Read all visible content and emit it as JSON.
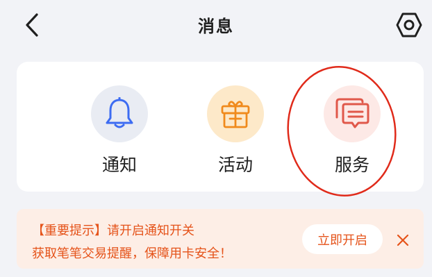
{
  "header": {
    "title": "消息",
    "back_icon": "chevron-left-icon",
    "settings_icon": "hexagon-gear-icon"
  },
  "categories": [
    {
      "label": "通知",
      "icon": "bell-icon",
      "bg_color": "#e9ecf3",
      "icon_color": "#3d6cf2"
    },
    {
      "label": "活动",
      "icon": "gift-icon",
      "bg_color": "#fde9c9",
      "icon_color": "#f08a1c"
    },
    {
      "label": "服务",
      "icon": "chat-bubbles-icon",
      "bg_color": "#fde9e6",
      "icon_color": "#e0584a"
    }
  ],
  "highlight_color": "#e02a1a",
  "notice": {
    "title": "【重要提示】请开启通知开关",
    "description": "获取笔笔交易提醒，保障用卡安全！",
    "enable_label": "立即开启",
    "close_icon": "close-icon",
    "text_color": "#e5531a",
    "bg_color": "#fdeee6"
  }
}
